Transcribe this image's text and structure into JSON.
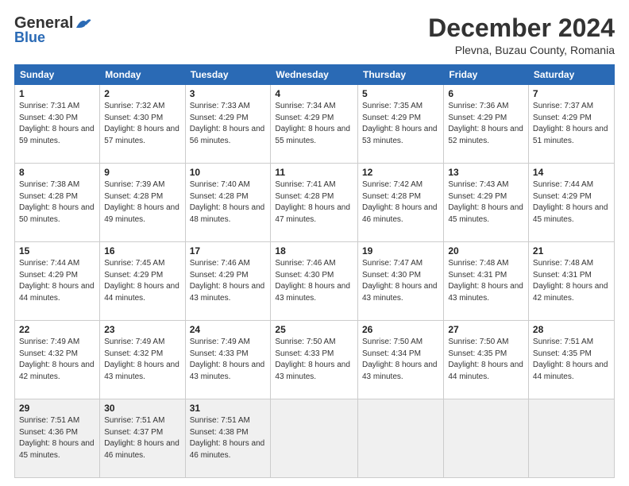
{
  "header": {
    "logo_line1": "General",
    "logo_line2": "Blue",
    "month": "December 2024",
    "location": "Plevna, Buzau County, Romania"
  },
  "days_of_week": [
    "Sunday",
    "Monday",
    "Tuesday",
    "Wednesday",
    "Thursday",
    "Friday",
    "Saturday"
  ],
  "weeks": [
    [
      {
        "day": "1",
        "sunrise": "7:31 AM",
        "sunset": "4:30 PM",
        "daylight": "8 hours and 59 minutes."
      },
      {
        "day": "2",
        "sunrise": "7:32 AM",
        "sunset": "4:30 PM",
        "daylight": "8 hours and 57 minutes."
      },
      {
        "day": "3",
        "sunrise": "7:33 AM",
        "sunset": "4:29 PM",
        "daylight": "8 hours and 56 minutes."
      },
      {
        "day": "4",
        "sunrise": "7:34 AM",
        "sunset": "4:29 PM",
        "daylight": "8 hours and 55 minutes."
      },
      {
        "day": "5",
        "sunrise": "7:35 AM",
        "sunset": "4:29 PM",
        "daylight": "8 hours and 53 minutes."
      },
      {
        "day": "6",
        "sunrise": "7:36 AM",
        "sunset": "4:29 PM",
        "daylight": "8 hours and 52 minutes."
      },
      {
        "day": "7",
        "sunrise": "7:37 AM",
        "sunset": "4:29 PM",
        "daylight": "8 hours and 51 minutes."
      }
    ],
    [
      {
        "day": "8",
        "sunrise": "7:38 AM",
        "sunset": "4:28 PM",
        "daylight": "8 hours and 50 minutes."
      },
      {
        "day": "9",
        "sunrise": "7:39 AM",
        "sunset": "4:28 PM",
        "daylight": "8 hours and 49 minutes."
      },
      {
        "day": "10",
        "sunrise": "7:40 AM",
        "sunset": "4:28 PM",
        "daylight": "8 hours and 48 minutes."
      },
      {
        "day": "11",
        "sunrise": "7:41 AM",
        "sunset": "4:28 PM",
        "daylight": "8 hours and 47 minutes."
      },
      {
        "day": "12",
        "sunrise": "7:42 AM",
        "sunset": "4:28 PM",
        "daylight": "8 hours and 46 minutes."
      },
      {
        "day": "13",
        "sunrise": "7:43 AM",
        "sunset": "4:29 PM",
        "daylight": "8 hours and 45 minutes."
      },
      {
        "day": "14",
        "sunrise": "7:44 AM",
        "sunset": "4:29 PM",
        "daylight": "8 hours and 45 minutes."
      }
    ],
    [
      {
        "day": "15",
        "sunrise": "7:44 AM",
        "sunset": "4:29 PM",
        "daylight": "8 hours and 44 minutes."
      },
      {
        "day": "16",
        "sunrise": "7:45 AM",
        "sunset": "4:29 PM",
        "daylight": "8 hours and 44 minutes."
      },
      {
        "day": "17",
        "sunrise": "7:46 AM",
        "sunset": "4:29 PM",
        "daylight": "8 hours and 43 minutes."
      },
      {
        "day": "18",
        "sunrise": "7:46 AM",
        "sunset": "4:30 PM",
        "daylight": "8 hours and 43 minutes."
      },
      {
        "day": "19",
        "sunrise": "7:47 AM",
        "sunset": "4:30 PM",
        "daylight": "8 hours and 43 minutes."
      },
      {
        "day": "20",
        "sunrise": "7:48 AM",
        "sunset": "4:31 PM",
        "daylight": "8 hours and 43 minutes."
      },
      {
        "day": "21",
        "sunrise": "7:48 AM",
        "sunset": "4:31 PM",
        "daylight": "8 hours and 42 minutes."
      }
    ],
    [
      {
        "day": "22",
        "sunrise": "7:49 AM",
        "sunset": "4:32 PM",
        "daylight": "8 hours and 42 minutes."
      },
      {
        "day": "23",
        "sunrise": "7:49 AM",
        "sunset": "4:32 PM",
        "daylight": "8 hours and 43 minutes."
      },
      {
        "day": "24",
        "sunrise": "7:49 AM",
        "sunset": "4:33 PM",
        "daylight": "8 hours and 43 minutes."
      },
      {
        "day": "25",
        "sunrise": "7:50 AM",
        "sunset": "4:33 PM",
        "daylight": "8 hours and 43 minutes."
      },
      {
        "day": "26",
        "sunrise": "7:50 AM",
        "sunset": "4:34 PM",
        "daylight": "8 hours and 43 minutes."
      },
      {
        "day": "27",
        "sunrise": "7:50 AM",
        "sunset": "4:35 PM",
        "daylight": "8 hours and 44 minutes."
      },
      {
        "day": "28",
        "sunrise": "7:51 AM",
        "sunset": "4:35 PM",
        "daylight": "8 hours and 44 minutes."
      }
    ],
    [
      {
        "day": "29",
        "sunrise": "7:51 AM",
        "sunset": "4:36 PM",
        "daylight": "8 hours and 45 minutes."
      },
      {
        "day": "30",
        "sunrise": "7:51 AM",
        "sunset": "4:37 PM",
        "daylight": "8 hours and 46 minutes."
      },
      {
        "day": "31",
        "sunrise": "7:51 AM",
        "sunset": "4:38 PM",
        "daylight": "8 hours and 46 minutes."
      },
      null,
      null,
      null,
      null
    ]
  ]
}
